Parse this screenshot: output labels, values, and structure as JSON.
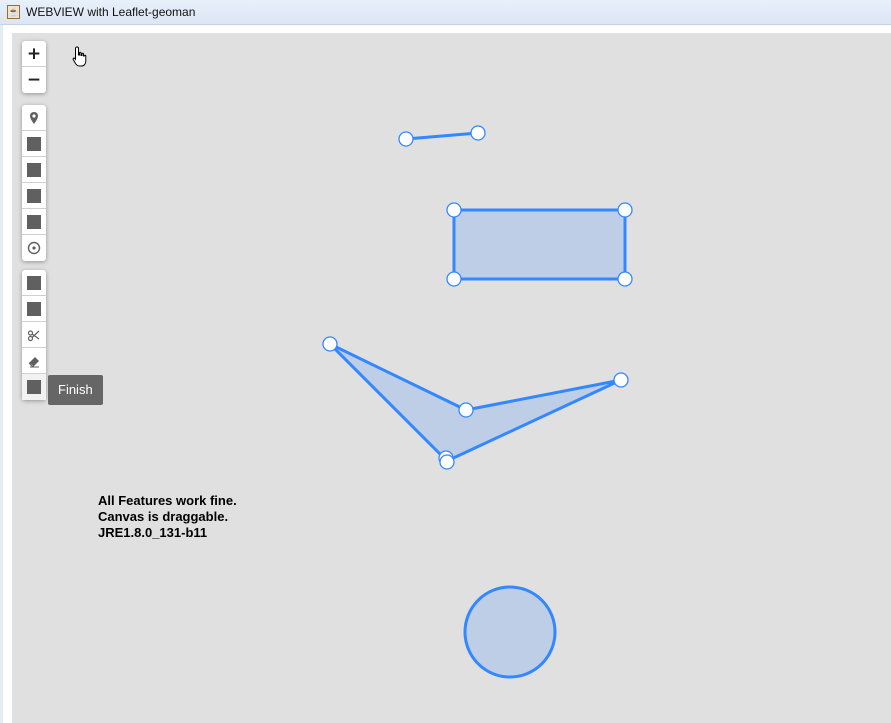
{
  "window": {
    "title": "WEBVIEW with Leaflet-geoman",
    "icon": "java-cup-icon"
  },
  "map": {
    "background": "#e0e0e0",
    "shape_color": "#3388ff",
    "shape_fill": "#3388ff"
  },
  "toolbar": {
    "zoom": [
      {
        "label": "+",
        "name": "zoom-in-button"
      },
      {
        "label": "−",
        "name": "zoom-out-button"
      }
    ],
    "draw_tools": [
      {
        "icon": "marker-icon",
        "name": "draw-marker-button"
      },
      {
        "icon": "polyline-icon",
        "name": "draw-polyline-button"
      },
      {
        "icon": "rectangle-icon",
        "name": "draw-rectangle-button"
      },
      {
        "icon": "polygon-icon",
        "name": "draw-polygon-button"
      },
      {
        "icon": "circle-icon",
        "name": "draw-circle-button"
      },
      {
        "icon": "circle-marker-icon",
        "name": "draw-circle-marker-button"
      }
    ],
    "edit_tools": [
      {
        "icon": "edit-icon",
        "name": "edit-layers-button"
      },
      {
        "icon": "drag-icon",
        "name": "drag-layers-button"
      },
      {
        "icon": "scissors-icon",
        "name": "cut-layers-button"
      },
      {
        "icon": "eraser-icon",
        "name": "remove-layers-button"
      },
      {
        "icon": "rotate-icon",
        "name": "rotate-layers-button"
      }
    ],
    "finish_label": "Finish"
  },
  "info": {
    "line1": "All Features work fine.",
    "line2": "Canvas is draggable.",
    "line3": "JRE1.8.0_131-b11"
  }
}
